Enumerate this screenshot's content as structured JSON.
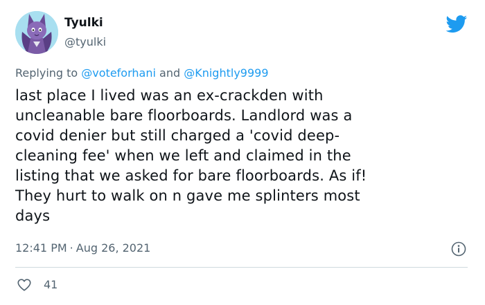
{
  "user": {
    "display_name": "Tyulki",
    "handle": "@tyulki",
    "avatar_icon": "furry-character-avatar"
  },
  "reply": {
    "prefix": "Replying to",
    "mention_1": "@voteforhani",
    "conjunction": "and",
    "mention_2": "@Knightly9999"
  },
  "tweet": {
    "lines": [
      "last place I lived was an ex-crackden with",
      "uncleanable bare floorboards. Landlord was a",
      "covid denier but still charged a 'covid deep-",
      "cleaning fee' when we left and claimed in the",
      "listing that we asked for bare floorboards. As if!",
      "They hurt to walk on n gave me splinters most",
      "days"
    ]
  },
  "meta": {
    "time": "12:41 PM",
    "separator": "·",
    "date": "Aug 26, 2021"
  },
  "actions": {
    "like_count": "41"
  },
  "colors": {
    "twitter_blue": "#1d9bf0",
    "text": "#0f1419",
    "muted": "#536471",
    "divider": "#cfd9de"
  },
  "icons": {
    "brand": "twitter-bird-icon",
    "info": "info-icon",
    "like": "heart-icon"
  }
}
